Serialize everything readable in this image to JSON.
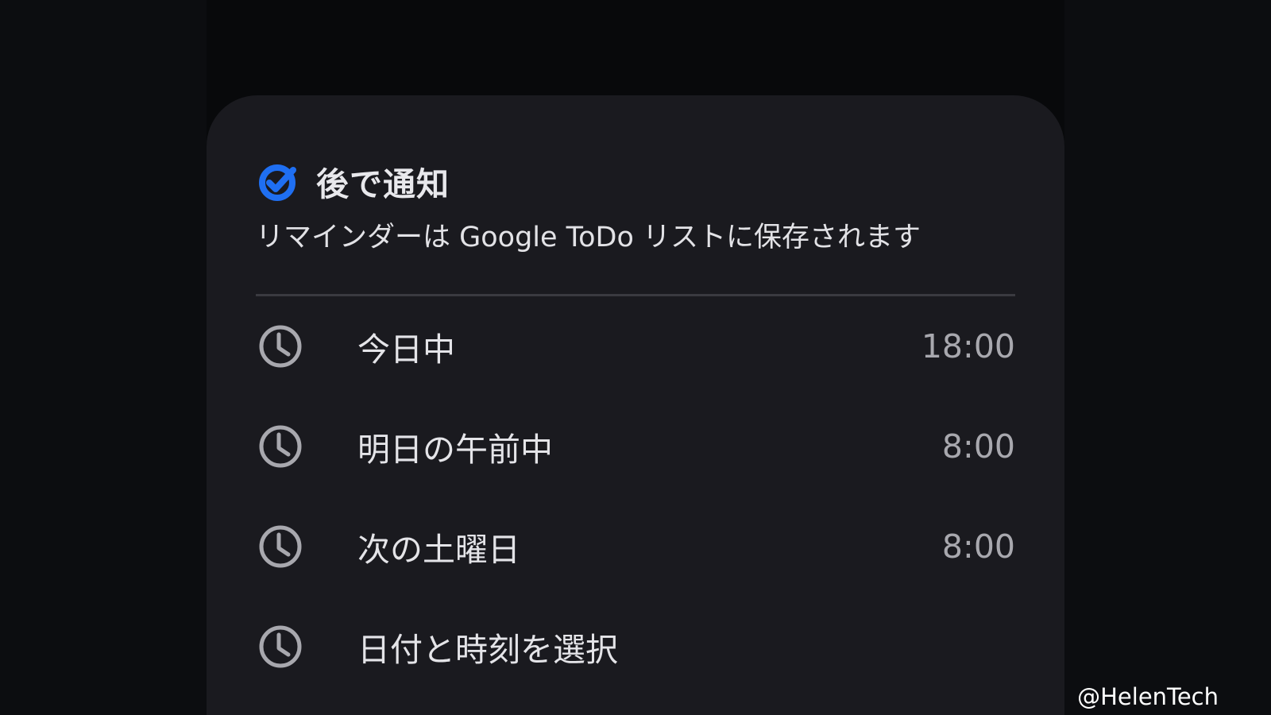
{
  "sheet": {
    "icon": "google-tasks-check-icon",
    "title": "後で通知",
    "subtitle": "リマインダーは Google ToDo リストに保存されます"
  },
  "options": [
    {
      "label": "今日中",
      "time": "18:00",
      "icon": "clock-icon"
    },
    {
      "label": "明日の午前中",
      "time": "8:00",
      "icon": "clock-icon"
    },
    {
      "label": "次の土曜日",
      "time": "8:00",
      "icon": "clock-icon"
    },
    {
      "label": "日付と時刻を選択",
      "time": "",
      "icon": "clock-icon"
    }
  ],
  "watermark": "@HelenTech",
  "colors": {
    "accent_blue": "#1f6ff2",
    "sheet_background": "#1a1a1f",
    "icon_gray": "#a8a8ae"
  }
}
